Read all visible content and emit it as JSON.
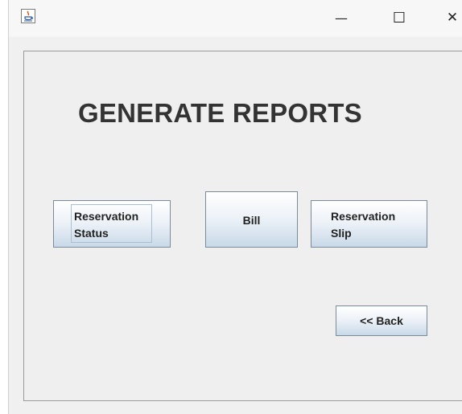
{
  "titlebar": {
    "minimize_glyph": "—",
    "maximize_glyph": "☐",
    "close_glyph": "✕"
  },
  "main": {
    "heading": "GENERATE REPORTS",
    "buttons": {
      "reservation_status": "Reservation\nStatus",
      "bill": "Bill",
      "reservation_slip": "Reservation\nSlip",
      "back": "<< Back"
    }
  },
  "icons": {
    "app": "java-app-icon",
    "minimize": "minimize-icon",
    "maximize": "maximize-icon",
    "close": "close-icon"
  }
}
